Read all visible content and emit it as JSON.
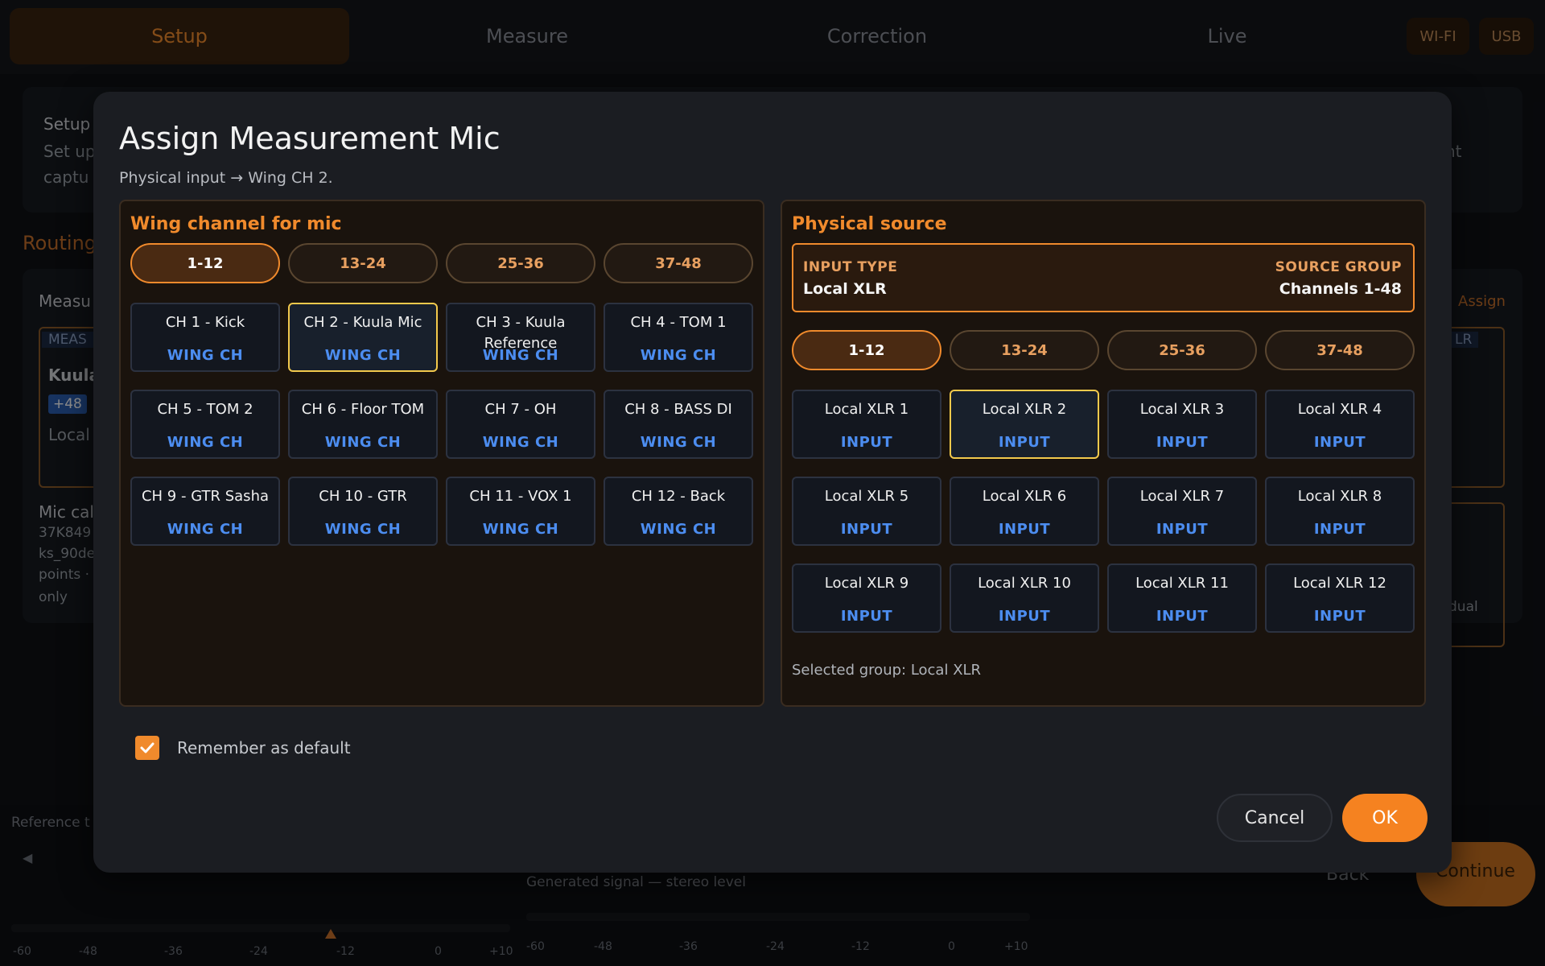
{
  "top_tabs": [
    {
      "label": "Setup",
      "active": true
    },
    {
      "label": "Measure",
      "active": false
    },
    {
      "label": "Correction",
      "active": false
    },
    {
      "label": "Live",
      "active": false
    }
  ],
  "top_actions": {
    "wifi": "WI-FI",
    "usb": "USB"
  },
  "background": {
    "setup_card_title": "Setup",
    "setup_card_line1": "Set up",
    "setup_card_line2": "captu",
    "setup_card_tail": "nt",
    "routing_heading": "Routing",
    "measure_label": "Measu",
    "assign_link": "Assign",
    "meas_strip": "MEAS",
    "lr_strip": "LR",
    "mic_name": "Kuula",
    "phantom_badge": "+48",
    "mic_source": "Local",
    "mic_cal_label": "Mic cal",
    "mic_cal_line1": "37K849",
    "mic_cal_line2": "ks_90de",
    "mic_cal_line3": "points ·",
    "mic_cal_line4": "only",
    "dual_text": "dual",
    "reference_label": "Reference t",
    "generated_signal": "Generated signal — stereo level",
    "back_button": "Back",
    "continue_button": "Continue",
    "scale_left": [
      "-60",
      "-48",
      "-36",
      "-24",
      "-12",
      "0",
      "+10"
    ],
    "scale_right": [
      "-60",
      "-48",
      "-36",
      "-24",
      "-12",
      "0",
      "+10"
    ]
  },
  "modal": {
    "title": "Assign Measurement Mic",
    "subtitle": "Physical input → Wing CH 2.",
    "left_panel": {
      "title": "Wing channel for mic",
      "ranges": [
        {
          "label": "1-12",
          "active": true
        },
        {
          "label": "13-24",
          "active": false
        },
        {
          "label": "25-36",
          "active": false
        },
        {
          "label": "37-48",
          "active": false
        }
      ],
      "channels": [
        {
          "name": "CH 1 - Kick",
          "sub": "WING CH",
          "selected": false
        },
        {
          "name": "CH 2 - Kuula Mic",
          "sub": "WING CH",
          "selected": true
        },
        {
          "name": "CH 3 - Kuula Reference",
          "sub": "WING CH",
          "selected": false
        },
        {
          "name": "CH 4 - TOM 1",
          "sub": "WING CH",
          "selected": false
        },
        {
          "name": "CH 5 - TOM 2",
          "sub": "WING CH",
          "selected": false
        },
        {
          "name": "CH 6 - Floor TOM",
          "sub": "WING CH",
          "selected": false
        },
        {
          "name": "CH 7 - OH",
          "sub": "WING CH",
          "selected": false
        },
        {
          "name": "CH 8 - BASS DI",
          "sub": "WING CH",
          "selected": false
        },
        {
          "name": "CH 9 - GTR Sasha",
          "sub": "WING CH",
          "selected": false
        },
        {
          "name": "CH 10 - GTR",
          "sub": "WING CH",
          "selected": false
        },
        {
          "name": "CH 11 - VOX 1",
          "sub": "WING CH",
          "selected": false
        },
        {
          "name": "CH 12 - Back",
          "sub": "WING CH",
          "selected": false
        }
      ]
    },
    "right_panel": {
      "title": "Physical source",
      "input_type_label": "INPUT TYPE",
      "input_type_value": "Local XLR",
      "source_group_label": "SOURCE GROUP",
      "source_group_value": "Channels 1-48",
      "ranges": [
        {
          "label": "1-12",
          "active": true
        },
        {
          "label": "13-24",
          "active": false
        },
        {
          "label": "25-36",
          "active": false
        },
        {
          "label": "37-48",
          "active": false
        }
      ],
      "inputs": [
        {
          "name": "Local XLR 1",
          "sub": "INPUT",
          "selected": false
        },
        {
          "name": "Local XLR 2",
          "sub": "INPUT",
          "selected": true
        },
        {
          "name": "Local XLR 3",
          "sub": "INPUT",
          "selected": false
        },
        {
          "name": "Local XLR 4",
          "sub": "INPUT",
          "selected": false
        },
        {
          "name": "Local XLR 5",
          "sub": "INPUT",
          "selected": false
        },
        {
          "name": "Local XLR 6",
          "sub": "INPUT",
          "selected": false
        },
        {
          "name": "Local XLR 7",
          "sub": "INPUT",
          "selected": false
        },
        {
          "name": "Local XLR 8",
          "sub": "INPUT",
          "selected": false
        },
        {
          "name": "Local XLR 9",
          "sub": "INPUT",
          "selected": false
        },
        {
          "name": "Local XLR 10",
          "sub": "INPUT",
          "selected": false
        },
        {
          "name": "Local XLR 11",
          "sub": "INPUT",
          "selected": false
        },
        {
          "name": "Local XLR 12",
          "sub": "INPUT",
          "selected": false
        }
      ],
      "selected_group": "Selected group: Local XLR"
    },
    "remember_default": {
      "label": "Remember as default",
      "checked": true
    },
    "cancel_label": "Cancel",
    "ok_label": "OK"
  },
  "colors": {
    "accent": "#f58220",
    "selected_border": "#f2c94c",
    "link_blue": "#4c8df0",
    "panel_title": "#f08a2c"
  }
}
